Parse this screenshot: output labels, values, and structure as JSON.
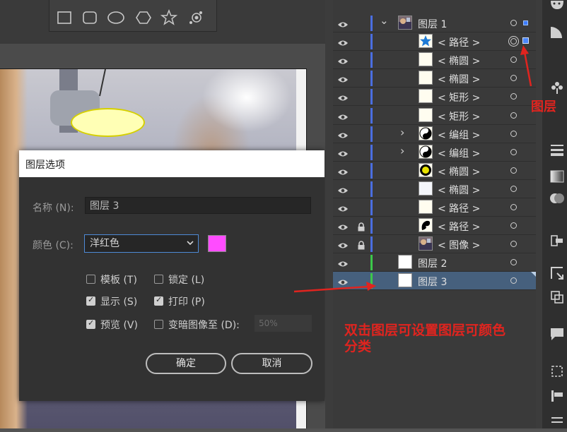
{
  "dialog": {
    "title": "图层选项",
    "name_label": "名称 (N):",
    "name_value": "图层 3",
    "color_label": "颜色 (C):",
    "color_value": "洋红色",
    "color_swatch": "#ff4cff",
    "options": {
      "template": {
        "label": "模板 (T)",
        "checked": false
      },
      "lock": {
        "label": "锁定 (L)",
        "checked": false
      },
      "show": {
        "label": "显示 (S)",
        "checked": true
      },
      "print": {
        "label": "打印 (P)",
        "checked": true
      },
      "preview": {
        "label": "预览 (V)",
        "checked": true
      },
      "dim": {
        "label": "变暗图像至 (D):",
        "checked": false,
        "value": "50%"
      }
    },
    "ok_label": "确定",
    "cancel_label": "取消"
  },
  "layers": [
    {
      "name": "图层 1",
      "level": 0,
      "expanded": true,
      "colorbar": "#4a6ee0",
      "thumb": "photo",
      "locked": false,
      "selected_square": true
    },
    {
      "name": "< 路径 >",
      "level": 1,
      "colorbar": "#4a6ee0",
      "thumb": "star-icon",
      "target": "double",
      "selected_square": true,
      "big_square": true
    },
    {
      "name": "< 椭圆 >",
      "level": 1,
      "colorbar": "#4a6ee0",
      "thumb": "blank"
    },
    {
      "name": "< 椭圆 >",
      "level": 1,
      "colorbar": "#4a6ee0",
      "thumb": "blank"
    },
    {
      "name": "< 矩形 >",
      "level": 1,
      "colorbar": "#4a6ee0",
      "thumb": "blank"
    },
    {
      "name": "< 矩形 >",
      "level": 1,
      "colorbar": "#4a6ee0",
      "thumb": "blank"
    },
    {
      "name": "< 编组 >",
      "level": 1,
      "colorbar": "#4a6ee0",
      "thumb": "yinyang-icon",
      "twisty": true
    },
    {
      "name": "< 编组 >",
      "level": 1,
      "colorbar": "#4a6ee0",
      "thumb": "yinyang-icon",
      "twisty": true
    },
    {
      "name": "< 椭圆 >",
      "level": 1,
      "colorbar": "#4a6ee0",
      "thumb": "yellow-circle-icon"
    },
    {
      "name": "< 椭圆 >",
      "level": 1,
      "colorbar": "#4a6ee0",
      "thumb": "blank-white"
    },
    {
      "name": "< 路径 >",
      "level": 1,
      "colorbar": "#4a6ee0",
      "thumb": "blank"
    },
    {
      "name": "< 路径 >",
      "level": 1,
      "colorbar": "#4a6ee0",
      "thumb": "swirl-icon",
      "locked": true
    },
    {
      "name": "< 图像 >",
      "level": 1,
      "colorbar": "#4a6ee0",
      "thumb": "photo",
      "locked": true
    },
    {
      "name": "图层 2",
      "level": 0,
      "colorbar": "#3cc84a",
      "thumb": "white"
    },
    {
      "name": "图层 3",
      "level": 0,
      "colorbar": "#3cc84a",
      "thumb": "white",
      "selected": true
    }
  ],
  "annotations": {
    "main": "双击图层可设置图层可颜色分类",
    "right": "图层"
  },
  "shape_tools": [
    "rectangle-tool-icon",
    "rounded-rectangle-tool-icon",
    "ellipse-tool-icon",
    "polygon-tool-icon",
    "star-tool-icon",
    "flare-tool-icon"
  ],
  "colors": {
    "accent": "#4e8ad6",
    "annotation_red": "#e0241f",
    "selected_row": "#46607d"
  }
}
